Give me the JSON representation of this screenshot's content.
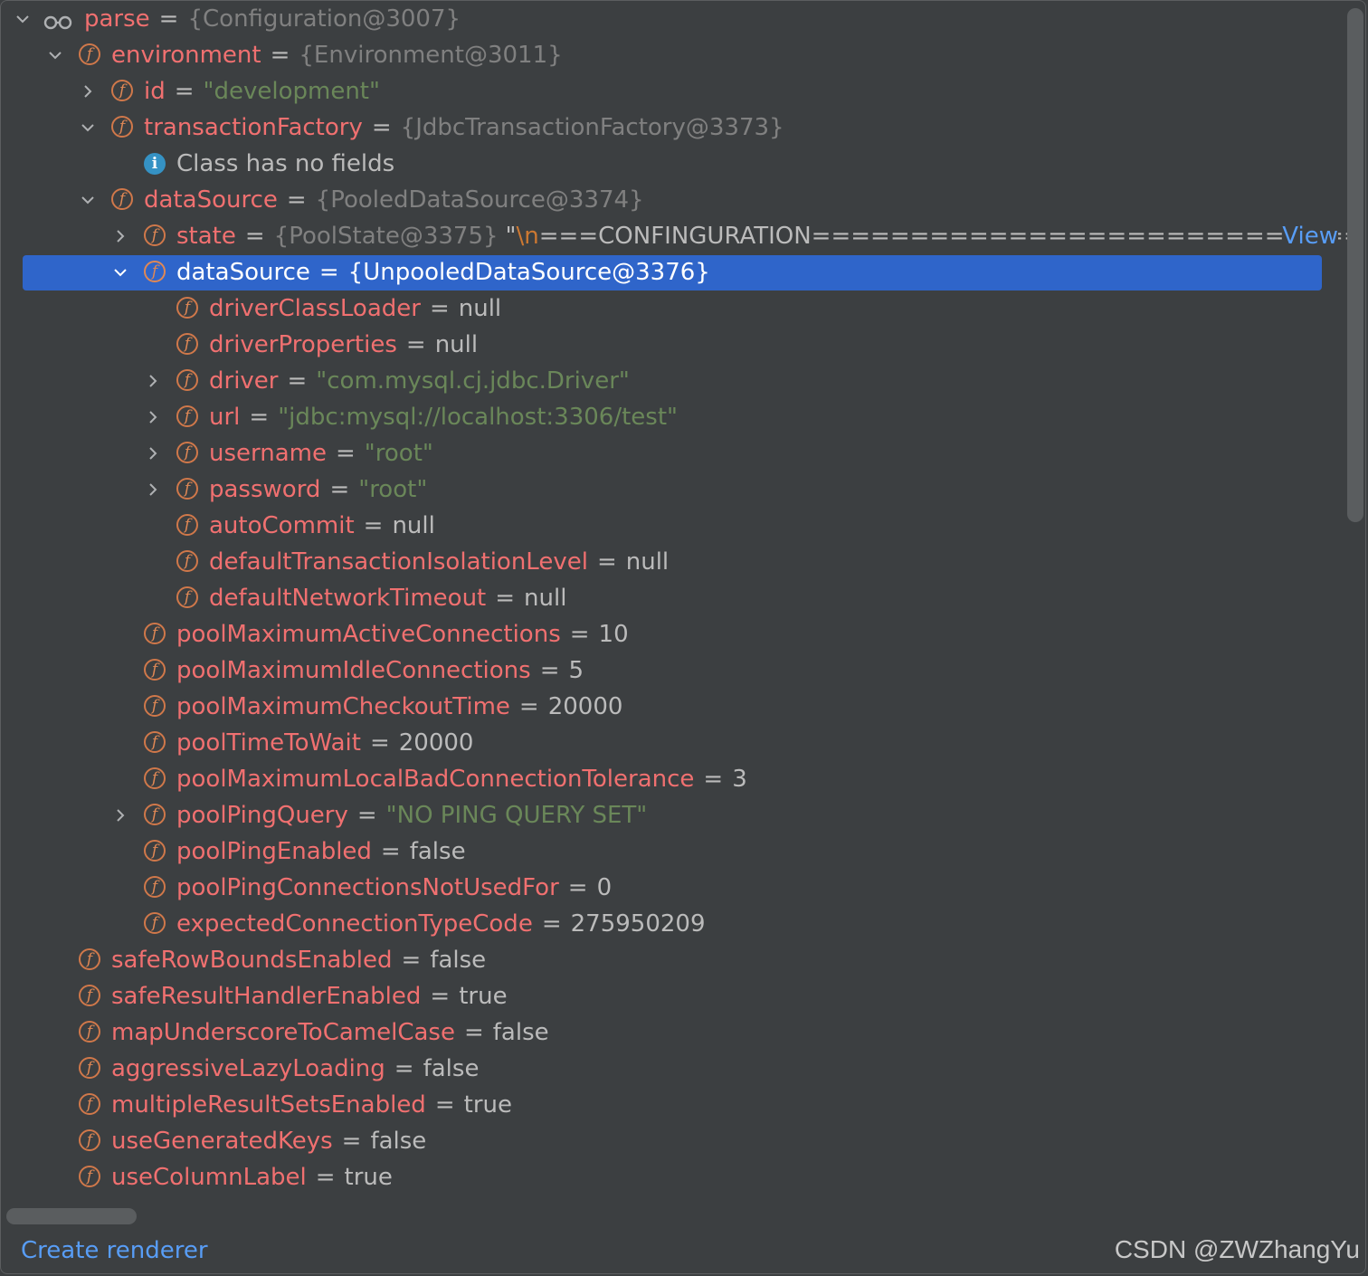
{
  "tree": {
    "rows": [
      {
        "depth": 0,
        "toggle": "open",
        "icon": "watch",
        "name": "parse",
        "value_kind": "type",
        "value": "{Configuration@3007}"
      },
      {
        "depth": 1,
        "toggle": "open",
        "icon": "field",
        "name": "environment",
        "value_kind": "type",
        "value": "{Environment@3011}"
      },
      {
        "depth": 2,
        "toggle": "closed",
        "icon": "field",
        "name": "id",
        "value_kind": "str",
        "value": "\"development\""
      },
      {
        "depth": 2,
        "toggle": "open",
        "icon": "field",
        "name": "transactionFactory",
        "value_kind": "type",
        "value": "{JdbcTransactionFactory@3373}"
      },
      {
        "depth": 3,
        "toggle": "none",
        "icon": "info",
        "name": "",
        "value_kind": "msg",
        "value": "Class has no fields"
      },
      {
        "depth": 2,
        "toggle": "open",
        "icon": "field",
        "name": "dataSource",
        "value_kind": "type",
        "value": "{PooledDataSource@3374}"
      },
      {
        "depth": 3,
        "toggle": "closed",
        "icon": "field",
        "name": "state",
        "value_kind": "state",
        "value": "{PoolState@3375}",
        "extra_pre": "\"",
        "extra_esc": "\\n",
        "extra_post": "===CONFINGURATION=============================...",
        "link": "View"
      },
      {
        "depth": 3,
        "toggle": "open",
        "icon": "field",
        "name": "dataSource",
        "value_kind": "type",
        "value": "{UnpooledDataSource@3376}",
        "selected": true
      },
      {
        "depth": 4,
        "toggle": "none",
        "icon": "field",
        "name": "driverClassLoader",
        "value_kind": "plain",
        "value": "null"
      },
      {
        "depth": 4,
        "toggle": "none",
        "icon": "field",
        "name": "driverProperties",
        "value_kind": "plain",
        "value": "null"
      },
      {
        "depth": 4,
        "toggle": "closed",
        "icon": "field",
        "name": "driver",
        "value_kind": "str",
        "value": "\"com.mysql.cj.jdbc.Driver\""
      },
      {
        "depth": 4,
        "toggle": "closed",
        "icon": "field",
        "name": "url",
        "value_kind": "str",
        "value": "\"jdbc:mysql://localhost:3306/test\""
      },
      {
        "depth": 4,
        "toggle": "closed",
        "icon": "field",
        "name": "username",
        "value_kind": "str",
        "value": "\"root\""
      },
      {
        "depth": 4,
        "toggle": "closed",
        "icon": "field",
        "name": "password",
        "value_kind": "str",
        "value": "\"root\""
      },
      {
        "depth": 4,
        "toggle": "none",
        "icon": "field",
        "name": "autoCommit",
        "value_kind": "plain",
        "value": "null"
      },
      {
        "depth": 4,
        "toggle": "none",
        "icon": "field",
        "name": "defaultTransactionIsolationLevel",
        "value_kind": "plain",
        "value": "null"
      },
      {
        "depth": 4,
        "toggle": "none",
        "icon": "field",
        "name": "defaultNetworkTimeout",
        "value_kind": "plain",
        "value": "null"
      },
      {
        "depth": 3,
        "toggle": "none",
        "icon": "field",
        "name": "poolMaximumActiveConnections",
        "value_kind": "plain",
        "value": "10"
      },
      {
        "depth": 3,
        "toggle": "none",
        "icon": "field",
        "name": "poolMaximumIdleConnections",
        "value_kind": "plain",
        "value": "5"
      },
      {
        "depth": 3,
        "toggle": "none",
        "icon": "field",
        "name": "poolMaximumCheckoutTime",
        "value_kind": "plain",
        "value": "20000"
      },
      {
        "depth": 3,
        "toggle": "none",
        "icon": "field",
        "name": "poolTimeToWait",
        "value_kind": "plain",
        "value": "20000"
      },
      {
        "depth": 3,
        "toggle": "none",
        "icon": "field",
        "name": "poolMaximumLocalBadConnectionTolerance",
        "value_kind": "plain",
        "value": "3"
      },
      {
        "depth": 3,
        "toggle": "closed",
        "icon": "field",
        "name": "poolPingQuery",
        "value_kind": "str",
        "value": "\"NO PING QUERY SET\""
      },
      {
        "depth": 3,
        "toggle": "none",
        "icon": "field",
        "name": "poolPingEnabled",
        "value_kind": "plain",
        "value": "false"
      },
      {
        "depth": 3,
        "toggle": "none",
        "icon": "field",
        "name": "poolPingConnectionsNotUsedFor",
        "value_kind": "plain",
        "value": "0"
      },
      {
        "depth": 3,
        "toggle": "none",
        "icon": "field",
        "name": "expectedConnectionTypeCode",
        "value_kind": "plain",
        "value": "275950209"
      },
      {
        "depth": 1,
        "toggle": "none",
        "icon": "field",
        "name": "safeRowBoundsEnabled",
        "value_kind": "plain",
        "value": "false"
      },
      {
        "depth": 1,
        "toggle": "none",
        "icon": "field",
        "name": "safeResultHandlerEnabled",
        "value_kind": "plain",
        "value": "true"
      },
      {
        "depth": 1,
        "toggle": "none",
        "icon": "field",
        "name": "mapUnderscoreToCamelCase",
        "value_kind": "plain",
        "value": "false"
      },
      {
        "depth": 1,
        "toggle": "none",
        "icon": "field",
        "name": "aggressiveLazyLoading",
        "value_kind": "plain",
        "value": "false"
      },
      {
        "depth": 1,
        "toggle": "none",
        "icon": "field",
        "name": "multipleResultSetsEnabled",
        "value_kind": "plain",
        "value": "true"
      },
      {
        "depth": 1,
        "toggle": "none",
        "icon": "field",
        "name": "useGeneratedKeys",
        "value_kind": "plain",
        "value": "false"
      },
      {
        "depth": 1,
        "toggle": "none",
        "icon": "field",
        "name": "useColumnLabel",
        "value_kind": "plain",
        "value": "true"
      }
    ],
    "icon_names": {
      "field": "field-icon",
      "watch": "watch-glasses-icon",
      "info": "info-icon",
      "open": "chevron-down-icon",
      "closed": "chevron-right-icon"
    },
    "field_letter": "f",
    "info_letter": "i",
    "equals": "="
  },
  "footer": {
    "create_renderer": "Create renderer",
    "watermark": "CSDN @ZWZhangYu"
  },
  "colors": {
    "background": "#3c3f41",
    "selection": "#2f65ca",
    "field_name": "#f07070",
    "string_value": "#6a8759",
    "type_value": "#808080",
    "link": "#589df6",
    "field_icon": "#e08855"
  }
}
